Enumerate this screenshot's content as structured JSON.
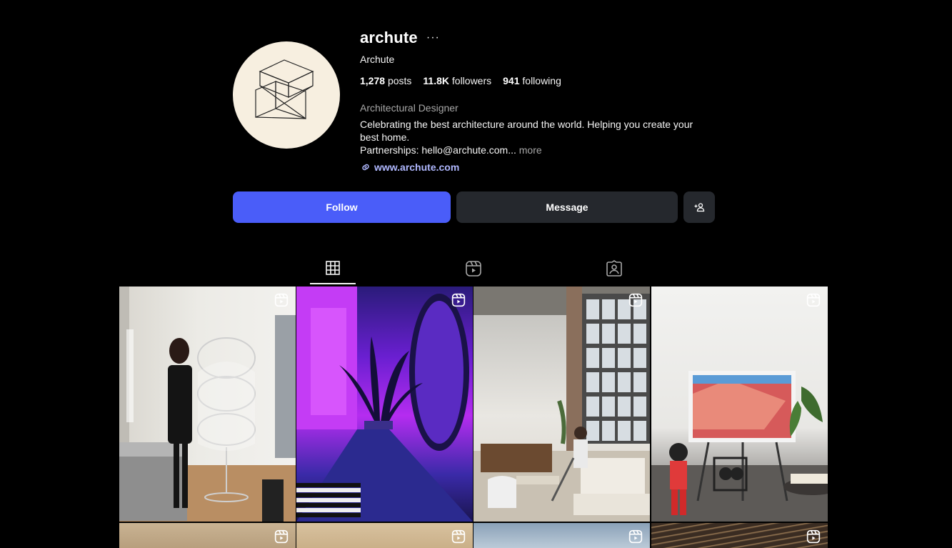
{
  "profile": {
    "username": "archute",
    "more_icon": "ellipsis-icon",
    "full_name": "Archute",
    "stats": {
      "posts_count": "1,278",
      "posts_label": "posts",
      "followers_count": "11.8K",
      "followers_label": "followers",
      "following_count": "941",
      "following_label": "following"
    },
    "category": "Architectural Designer",
    "bio_line1": "Celebrating the best architecture around the world. Helping you create your best home.",
    "bio_line2": "Partnerships: hello@archute.com...",
    "bio_more": "more",
    "link_icon": "link-icon",
    "website": "www.archute.com",
    "avatar_bg": "#f7efe0"
  },
  "actions": {
    "follow_label": "Follow",
    "message_label": "Message",
    "suggest_icon": "add-person-icon"
  },
  "colors": {
    "follow_bg": "#4a5df9",
    "secondary_bg": "#25282d",
    "page_bg": "#000000",
    "link_color": "#b0b8ff"
  },
  "tabs": [
    {
      "name": "posts",
      "icon": "grid-icon",
      "active": true
    },
    {
      "name": "reels",
      "icon": "reels-icon",
      "active": false
    },
    {
      "name": "tagged",
      "icon": "tagged-icon",
      "active": false
    }
  ],
  "grid": {
    "tiles": [
      {
        "type": "reel",
        "scene": "woman with wire rack in white room"
      },
      {
        "type": "reel",
        "scene": "purple neon hallway with palm"
      },
      {
        "type": "reel",
        "scene": "loft living room with large windows"
      },
      {
        "type": "reel",
        "scene": "room with TV on easel and figure"
      },
      {
        "type": "reel"
      },
      {
        "type": "reel"
      },
      {
        "type": "reel"
      },
      {
        "type": "reel"
      }
    ],
    "badge_icon": "reel-badge-icon"
  }
}
